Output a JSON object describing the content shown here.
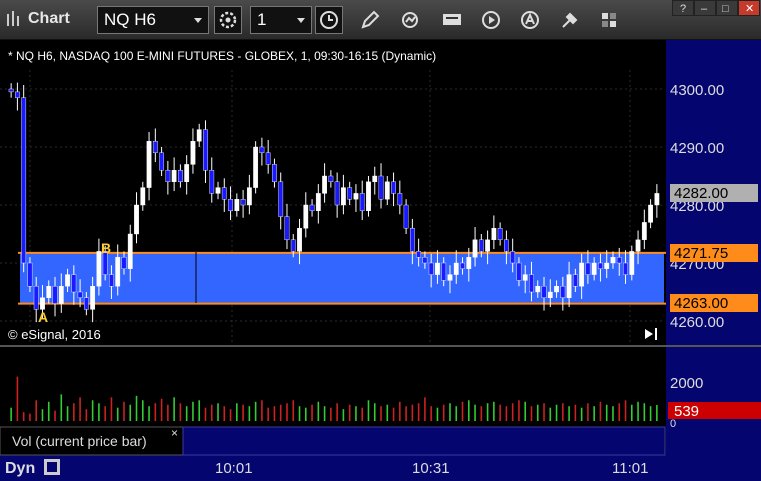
{
  "toolbar": {
    "title": "Chart",
    "symbol": "NQ H6",
    "interval": "1",
    "icons": [
      "chart-logo-icon",
      "gear-icon",
      "clock-icon",
      "pencil-icon",
      "cycle-icon",
      "get-icon",
      "play-icon",
      "alert-icon",
      "tools-icon",
      "color-icon"
    ],
    "window_buttons": [
      "help-icon",
      "minimize-icon",
      "maximize-icon",
      "close-icon"
    ],
    "window_glyphs": {
      "help": "?",
      "minimize": "–",
      "maximize": "□",
      "close": "✕"
    }
  },
  "chart": {
    "header": "* NQ H6, NASDAQ 100 E-MINI FUTURES - GLOBEX, 1, 09:30-16:15 (Dynamic)",
    "copyright": "© eSignal, 2016",
    "price_ticks": [
      "4300.00",
      "4290.00",
      "4280.00",
      "4270.00",
      "4260.00"
    ],
    "last_price": "4282.00",
    "upper_level": "4271.75",
    "lower_level": "4263.00",
    "marker_a": "A",
    "marker_b": "B",
    "volume_tick": "2000",
    "volume_tick_small": "0",
    "volume_last": "539",
    "volume_pane_label": "Vol (current price bar)",
    "volume_pane_close": "×",
    "time_ticks": [
      "10:01",
      "10:31",
      "11:01"
    ],
    "footer_mode": "Dyn",
    "footer_icon": "fit-icon",
    "colors": {
      "up_candle": "#ffffff",
      "down_candle": "#1a1aff",
      "zone_fill": "#3366ff",
      "level_line": "#ff8c1a",
      "last_price_badge": "#b0b0b0",
      "volume_up": "#33cc33",
      "volume_down": "#cc2222",
      "volume_badge": "#cc0000",
      "axis_bg": "#050570",
      "marker": "#ffcc33"
    }
  },
  "chart_data": {
    "type": "candlestick",
    "title": "* NQ H6, NASDAQ 100 E-MINI FUTURES - GLOBEX, 1, 09:30-16:15 (Dynamic)",
    "ylim": [
      4258,
      4307
    ],
    "xlabels": [
      "10:01",
      "10:31",
      "11:01"
    ],
    "shaded_zone": [
      4263.0,
      4271.75
    ],
    "closes": [
      4299.5,
      4298.5,
      4270,
      4266,
      4262,
      4264,
      4266,
      4263,
      4266,
      4268,
      4265,
      4264,
      4262,
      4266,
      4272,
      4268,
      4266,
      4271,
      4269,
      4275,
      4280,
      4283,
      4291,
      4289,
      4286,
      4284,
      4286,
      4284,
      4287,
      4291,
      4293,
      4286,
      4282,
      4283,
      4281,
      4279,
      4281,
      4280,
      4283,
      4290,
      4289,
      4287,
      4284,
      4278,
      4274,
      4272,
      4276,
      4280,
      4279,
      4282,
      4285,
      4284,
      4280,
      4283,
      4281,
      4282,
      4279,
      4284,
      4285,
      4281,
      4284,
      4282,
      4280,
      4276,
      4272,
      4271,
      4270,
      4268,
      4270,
      4267,
      4268,
      4270,
      4269,
      4271,
      4274,
      4272,
      4274,
      4276,
      4274,
      4272,
      4270,
      4267,
      4268,
      4265,
      4266,
      4264,
      4265,
      4266,
      4264,
      4268,
      4266,
      4270,
      4268,
      4270,
      4269,
      4270,
      4271,
      4270,
      4268,
      4272,
      4274,
      4277,
      4280,
      4282
    ],
    "volume": [
      450,
      1500,
      300,
      250,
      700,
      400,
      650,
      350,
      900,
      500,
      600,
      800,
      400,
      700,
      600,
      500,
      800,
      450,
      650,
      550,
      850,
      700,
      500,
      600,
      750,
      550,
      800,
      600,
      500,
      650,
      700,
      450,
      550,
      600,
      500,
      400,
      600,
      550,
      500,
      650,
      700,
      450,
      500,
      550,
      600,
      700,
      500,
      450,
      550,
      650,
      500,
      450,
      600,
      400,
      550,
      500,
      450,
      700,
      600,
      500,
      550,
      450,
      650,
      500,
      550,
      600,
      800,
      500,
      450,
      550,
      600,
      500,
      650,
      700,
      550,
      500,
      600,
      650,
      550,
      500,
      600,
      700,
      650,
      500,
      550,
      600,
      450,
      550,
      600,
      500,
      550,
      450,
      600,
      500,
      650,
      550,
      500,
      600,
      700,
      550,
      650,
      600,
      500,
      539
    ],
    "volume_ylim": [
      0,
      2400
    ],
    "last_price": 4282.0,
    "last_volume": 539
  }
}
